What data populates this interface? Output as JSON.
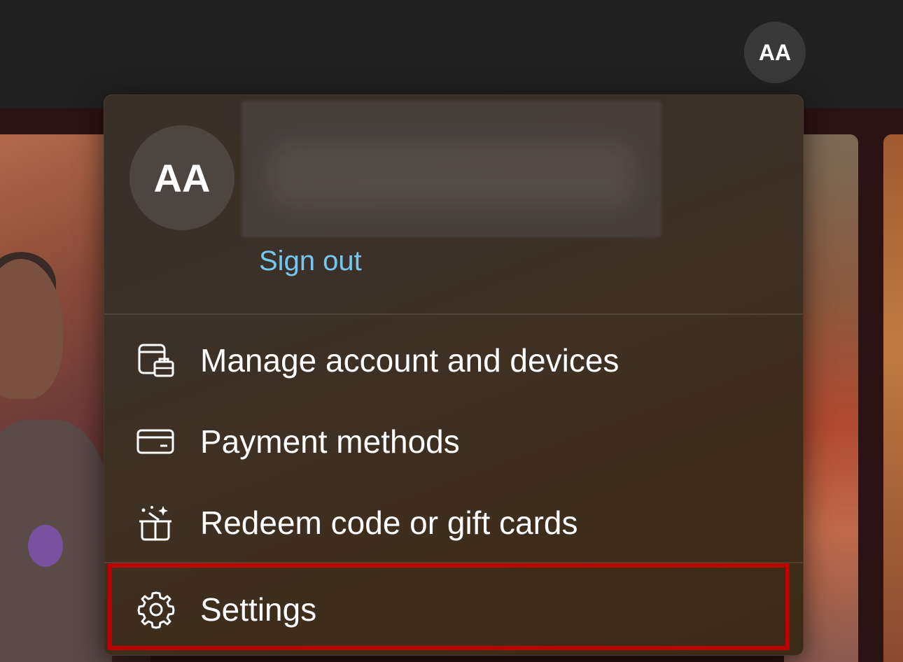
{
  "topbar": {
    "avatar_initials": "AA"
  },
  "account_menu": {
    "avatar_initials": "AA",
    "sign_out_label": "Sign out",
    "items": [
      {
        "label": "Manage account and devices",
        "icon": "account-devices-icon"
      },
      {
        "label": "Payment methods",
        "icon": "credit-card-icon"
      },
      {
        "label": "Redeem code or gift cards",
        "icon": "gift-icon"
      },
      {
        "label": "Settings",
        "icon": "gear-icon"
      }
    ]
  },
  "colors": {
    "link": "#74c8f0",
    "highlight": "#c00000",
    "topbar": "#202020"
  }
}
